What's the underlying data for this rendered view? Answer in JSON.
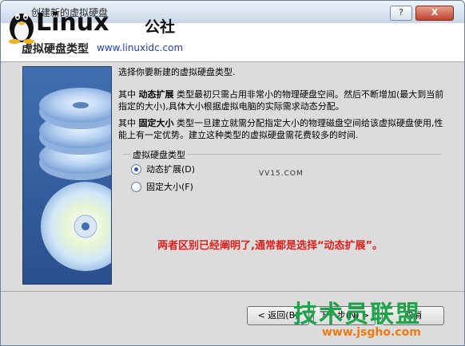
{
  "window": {
    "title": "创建新的虚拟硬盘",
    "help_label": "?",
    "close_label": "X"
  },
  "header": {
    "title": "虚拟硬盘类型"
  },
  "logo": {
    "word": "Linux",
    "cn": "公社",
    "url": "www.linuxidc.com"
  },
  "content": {
    "intro": "选择你要新建的虚拟硬盘类型.",
    "dynamic_prefix": "其中",
    "dynamic_term": "动态扩展",
    "dynamic_desc": "类型最初只需占用非常小的物理硬盘空间。然后不断增加(最大到当前指定的大小),具体大小根据虚拟电脑的实际需求动态分配。",
    "fixed_prefix": "其中",
    "fixed_term": "固定大小",
    "fixed_desc": "类型一旦建立就需分配指定大小的物理磁盘空间给该虚拟硬盘使用,性能上有一定优势。建立这种类型的虚拟硬盘需花费较多的时间."
  },
  "disk_type": {
    "legend": "虚拟硬盘类型",
    "options": [
      {
        "label": "动态扩展(D)",
        "checked": true
      },
      {
        "label": "固定大小(F)",
        "checked": false
      }
    ]
  },
  "watermark_small": "VV15.COM",
  "annotation": "两者区别已经阐明了,通常都是选择“动态扩展”。",
  "buttons": {
    "back": "< 返回(B)",
    "next": "下一步(N) >",
    "cancel": "取消"
  },
  "brand_watermark": {
    "name": "技术员联盟",
    "url": "www.jsgho.com"
  },
  "colors": {
    "annotation": "#e0201c",
    "brand_green": "#1da34a",
    "brand_orange": "#f07a12",
    "dialog_bg": "#dcdcdc"
  }
}
